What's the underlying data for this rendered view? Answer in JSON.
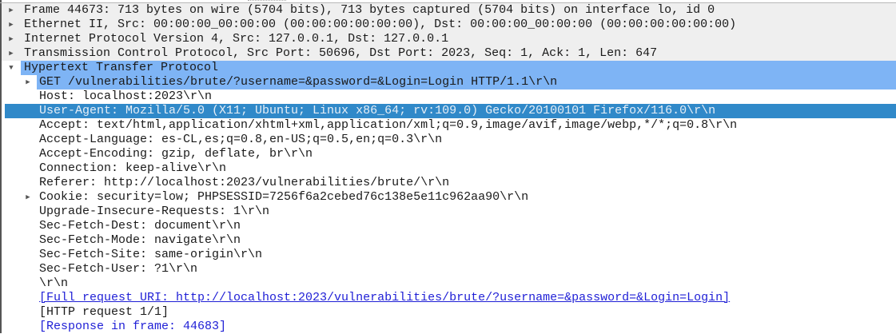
{
  "colors": {
    "section_bg": "#efefef",
    "highlight": "#7eb4f5",
    "selected": "#3089c9",
    "link": "#1f1fd6"
  },
  "tree": [
    {
      "text": "Frame 44673: 713 bytes on wire (5704 bits), 713 bytes captured (5704 bits) on interface lo, id 0",
      "level": 0,
      "expander": "collapsed",
      "style": "gray"
    },
    {
      "text": "Ethernet II, Src: 00:00:00_00:00:00 (00:00:00:00:00:00), Dst: 00:00:00_00:00:00 (00:00:00:00:00:00)",
      "level": 0,
      "expander": "collapsed",
      "style": "gray"
    },
    {
      "text": "Internet Protocol Version 4, Src: 127.0.0.1, Dst: 127.0.0.1",
      "level": 0,
      "expander": "collapsed",
      "style": "gray"
    },
    {
      "text": "Transmission Control Protocol, Src Port: 50696, Dst Port: 2023, Seq: 1, Ack: 1, Len: 647",
      "level": 0,
      "expander": "collapsed",
      "style": "gray"
    },
    {
      "text": "Hypertext Transfer Protocol",
      "level": 0,
      "expander": "expanded",
      "style": "hl"
    },
    {
      "text": "GET /vulnerabilities/brute/?username=&password=&Login=Login HTTP/1.1\\r\\n",
      "level": 1,
      "expander": "collapsed",
      "style": "hl"
    },
    {
      "text": "Host: localhost:2023\\r\\n",
      "level": 1,
      "expander": "none",
      "style": ""
    },
    {
      "text": "User-Agent: Mozilla/5.0 (X11; Ubuntu; Linux x86_64; rv:109.0) Gecko/20100101 Firefox/116.0\\r\\n",
      "level": 1,
      "expander": "none",
      "style": "sel"
    },
    {
      "text": "Accept: text/html,application/xhtml+xml,application/xml;q=0.9,image/avif,image/webp,*/*;q=0.8\\r\\n",
      "level": 1,
      "expander": "none",
      "style": ""
    },
    {
      "text": "Accept-Language: es-CL,es;q=0.8,en-US;q=0.5,en;q=0.3\\r\\n",
      "level": 1,
      "expander": "none",
      "style": ""
    },
    {
      "text": "Accept-Encoding: gzip, deflate, br\\r\\n",
      "level": 1,
      "expander": "none",
      "style": ""
    },
    {
      "text": "Connection: keep-alive\\r\\n",
      "level": 1,
      "expander": "none",
      "style": ""
    },
    {
      "text": "Referer: http://localhost:2023/vulnerabilities/brute/\\r\\n",
      "level": 1,
      "expander": "none",
      "style": ""
    },
    {
      "text": "Cookie: security=low; PHPSESSID=7256f6a2cebed76c138e5e11c962aa90\\r\\n",
      "level": 1,
      "expander": "collapsed",
      "style": ""
    },
    {
      "text": "Upgrade-Insecure-Requests: 1\\r\\n",
      "level": 1,
      "expander": "none",
      "style": ""
    },
    {
      "text": "Sec-Fetch-Dest: document\\r\\n",
      "level": 1,
      "expander": "none",
      "style": ""
    },
    {
      "text": "Sec-Fetch-Mode: navigate\\r\\n",
      "level": 1,
      "expander": "none",
      "style": ""
    },
    {
      "text": "Sec-Fetch-Site: same-origin\\r\\n",
      "level": 1,
      "expander": "none",
      "style": ""
    },
    {
      "text": "Sec-Fetch-User: ?1\\r\\n",
      "level": 1,
      "expander": "none",
      "style": ""
    },
    {
      "text": "\\r\\n",
      "level": 1,
      "expander": "none",
      "style": ""
    },
    {
      "text": "[Full request URI: http://localhost:2023/vulnerabilities/brute/?username=&password=&Login=Login]",
      "level": 1,
      "expander": "none",
      "style": "link ul"
    },
    {
      "text": "[HTTP request 1/1]",
      "level": 1,
      "expander": "none",
      "style": ""
    },
    {
      "text": "[Response in frame: 44683]",
      "level": 1,
      "expander": "none",
      "style": "link"
    }
  ]
}
